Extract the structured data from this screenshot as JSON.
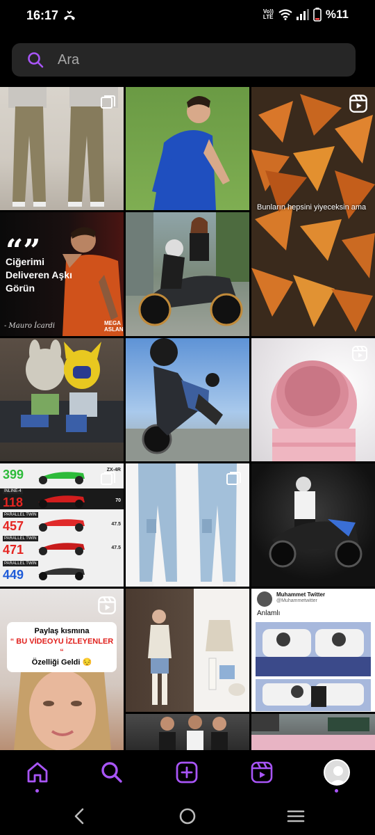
{
  "status_bar": {
    "time": "16:17",
    "network_label_top": "Vo))",
    "network_label_bottom": "LTE",
    "battery": "%11"
  },
  "search": {
    "placeholder": "Ara"
  },
  "tiles": {
    "quote": {
      "marks": "“”",
      "text": "Ciğerimi Deliveren Aşkı Görün",
      "signature": "- Mauro İcardi",
      "corner_label": "MEGA ASLAN"
    },
    "chips_caption": "Bunların hepsini yiyeceksin ama",
    "moto_specs": {
      "rows": [
        {
          "label": "",
          "number": "399",
          "right": "ZX-4R"
        },
        {
          "label": "INLINE-4",
          "number": "118",
          "right": "70"
        },
        {
          "label": "PARALLEL TWIN",
          "number": "457",
          "right": "47.5"
        },
        {
          "label": "PARALLEL TWIN",
          "number": "471",
          "right": "47.5"
        },
        {
          "label": "PARALLEL TWIN",
          "number": "449",
          "right": ""
        }
      ]
    },
    "reel_text": {
      "line1": "Paylaş kısmına",
      "line2": "“ BU VİDEOYU İZLEYENLER “",
      "line3": "Özelliği Geldi 😔"
    },
    "tweet": {
      "name": "Muhammet Twitter",
      "handle": "@Muhammetwitter",
      "text": "Anlamlı"
    }
  },
  "nav": {
    "items": [
      "home-icon",
      "search-icon",
      "create-icon",
      "reels-icon",
      "profile-avatar"
    ],
    "active": "search"
  },
  "colors": {
    "accent": "#a855f7",
    "background": "#000000",
    "search_bg": "#262626"
  }
}
